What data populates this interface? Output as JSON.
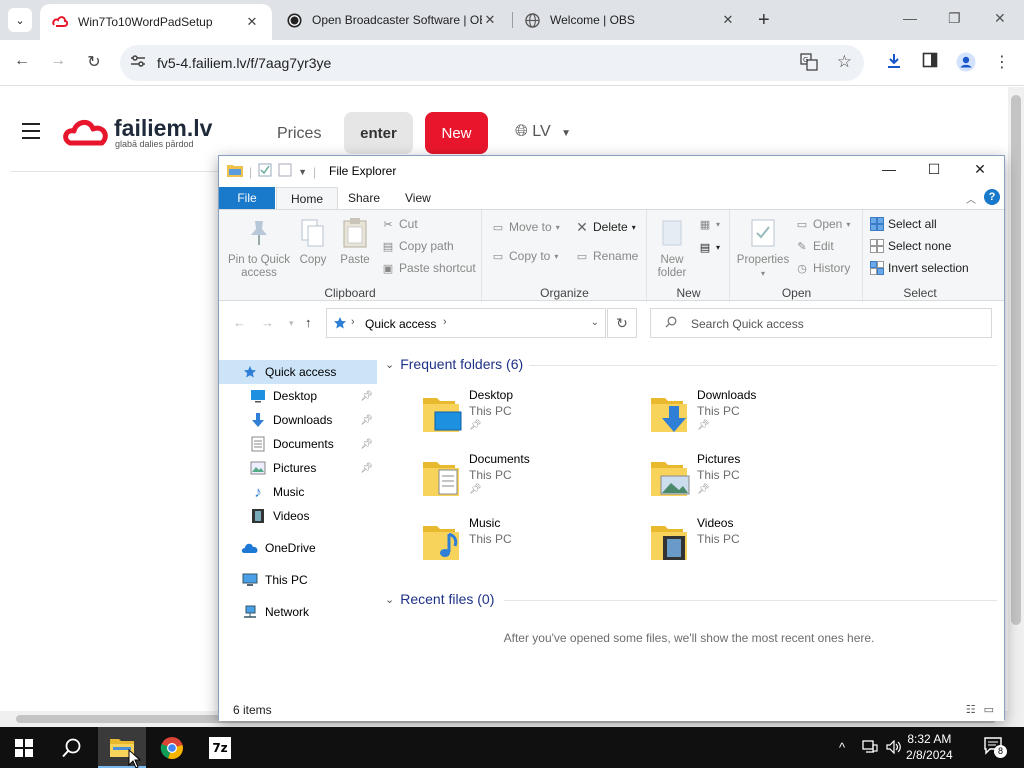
{
  "browser": {
    "tabs": [
      {
        "title": "Win7To10WordPadSetup",
        "active": true
      },
      {
        "title": "Open Broadcaster Software | OBS",
        "active": false
      },
      {
        "title": "Welcome | OBS",
        "active": false
      }
    ],
    "url": "fv5-4.failiem.lv/f/7aag7yr3ye"
  },
  "site": {
    "logo_name": "failiem.lv",
    "logo_tagline": "glabā  dalies  pārdod",
    "nav_prices": "Prices",
    "nav_enter": "enter",
    "nav_new": "New",
    "lang": "LV",
    "brand_color": "#e8162d"
  },
  "explorer": {
    "title": "File Explorer",
    "tabs": {
      "file": "File",
      "home": "Home",
      "share": "Share",
      "view": "View"
    },
    "ribbon": {
      "pin_quick_access_l1": "Pin to Quick",
      "pin_quick_access_l2": "access",
      "copy": "Copy",
      "paste": "Paste",
      "cut": "Cut",
      "copy_path": "Copy path",
      "paste_shortcut": "Paste shortcut",
      "clipboard": "Clipboard",
      "move_to": "Move to",
      "copy_to": "Copy to",
      "delete": "Delete",
      "rename": "Rename",
      "organize": "Organize",
      "new_folder_l1": "New",
      "new_folder_l2": "folder",
      "new": "New",
      "properties": "Properties",
      "open": "Open",
      "edit": "Edit",
      "history": "History",
      "open_group": "Open",
      "select_all": "Select all",
      "select_none": "Select none",
      "invert_selection": "Invert selection",
      "select": "Select"
    },
    "address": "Quick access",
    "search_placeholder": "Search Quick access",
    "nav": {
      "quick_access": "Quick access",
      "desktop": "Desktop",
      "downloads": "Downloads",
      "documents": "Documents",
      "pictures": "Pictures",
      "music": "Music",
      "videos": "Videos",
      "onedrive": "OneDrive",
      "this_pc": "This PC",
      "network": "Network"
    },
    "frequent_header": "Frequent folders (6)",
    "folders": [
      {
        "name": "Desktop",
        "loc": "This PC"
      },
      {
        "name": "Downloads",
        "loc": "This PC"
      },
      {
        "name": "Documents",
        "loc": "This PC"
      },
      {
        "name": "Pictures",
        "loc": "This PC"
      },
      {
        "name": "Music",
        "loc": "This PC"
      },
      {
        "name": "Videos",
        "loc": "This PC"
      }
    ],
    "recent_header": "Recent files (0)",
    "recent_empty": "After you've opened some files, we'll show the most recent ones here.",
    "status": "6 items"
  },
  "taskbar": {
    "time": "8:32 AM",
    "date": "2/8/2024",
    "notification_count": "8",
    "zip_label": "7z"
  }
}
